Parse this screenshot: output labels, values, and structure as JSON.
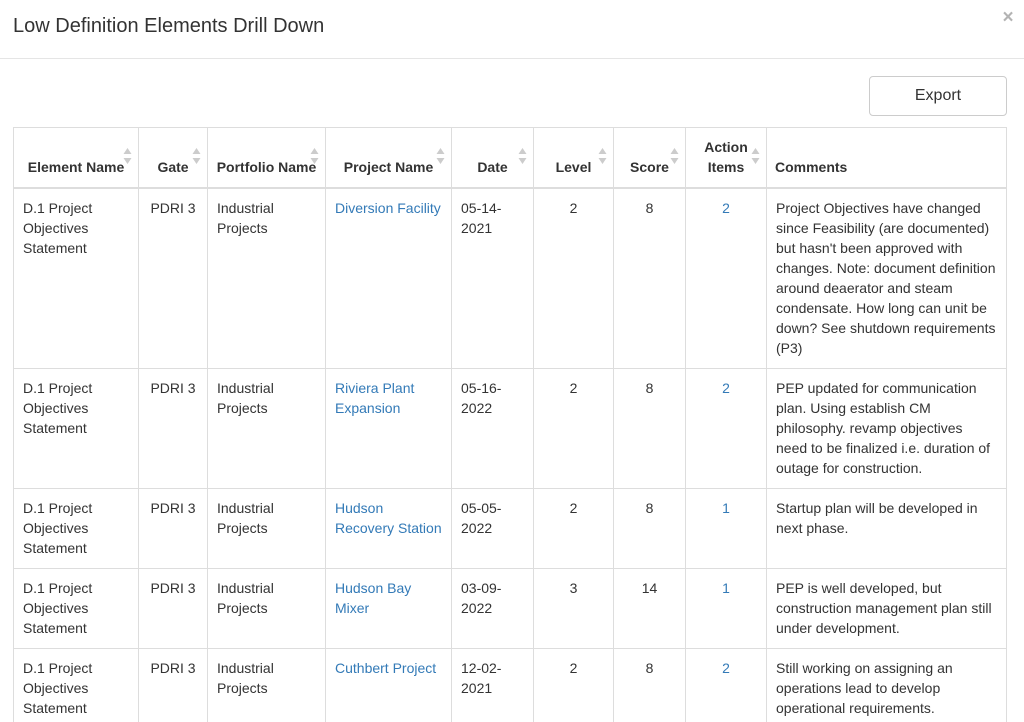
{
  "modal": {
    "title": "Low Definition Elements Drill Down",
    "close_symbol": "×",
    "export_label": "Export"
  },
  "table": {
    "headers": [
      {
        "label": "Element Name",
        "sortable": true
      },
      {
        "label": "Gate",
        "sortable": true
      },
      {
        "label": "Portfolio Name",
        "sortable": true
      },
      {
        "label": "Project Name",
        "sortable": true
      },
      {
        "label": "Date",
        "sortable": true
      },
      {
        "label": "Level",
        "sortable": true
      },
      {
        "label": "Score",
        "sortable": true
      },
      {
        "label": "Action Items",
        "sortable": true
      },
      {
        "label": "Comments",
        "sortable": false
      }
    ],
    "rows": [
      {
        "element": "D.1 Project Objectives Statement",
        "gate": "PDRI 3",
        "portfolio": "Industrial Projects",
        "project": "Diversion Facility",
        "date": "05-14-2021",
        "level": "2",
        "score": "8",
        "action_items": "2",
        "comments": "Project Objectives have changed since Feasibility (are documented) but hasn't been approved with changes. Note: document definition around deaerator and steam condensate. How long can unit be down? See shutdown requirements (P3)"
      },
      {
        "element": "D.1 Project Objectives Statement",
        "gate": "PDRI 3",
        "portfolio": "Industrial Projects",
        "project": "Riviera Plant Expansion",
        "date": "05-16-2022",
        "level": "2",
        "score": "8",
        "action_items": "2",
        "comments": "PEP updated for communication plan. Using establish CM philosophy. revamp objectives need to be finalized i.e. duration of outage for construction."
      },
      {
        "element": "D.1 Project Objectives Statement",
        "gate": "PDRI 3",
        "portfolio": "Industrial Projects",
        "project": "Hudson Recovery Station",
        "date": "05-05-2022",
        "level": "2",
        "score": "8",
        "action_items": "1",
        "comments": "Startup plan will be developed in next phase."
      },
      {
        "element": "D.1 Project Objectives Statement",
        "gate": "PDRI 3",
        "portfolio": "Industrial Projects",
        "project": "Hudson Bay Mixer",
        "date": "03-09-2022",
        "level": "3",
        "score": "14",
        "action_items": "1",
        "comments": "PEP is well developed, but construction management plan still under development."
      },
      {
        "element": "D.1 Project Objectives Statement",
        "gate": "PDRI 3",
        "portfolio": "Industrial Projects",
        "project": "Cuthbert Project",
        "date": "12-02-2021",
        "level": "2",
        "score": "8",
        "action_items": "2",
        "comments": "Still working on assigning an operations lead to develop operational requirements."
      }
    ]
  },
  "colors": {
    "link": "#337ab7",
    "text": "#333333",
    "border": "#dddddd",
    "sort_icon": "#cccccc"
  }
}
